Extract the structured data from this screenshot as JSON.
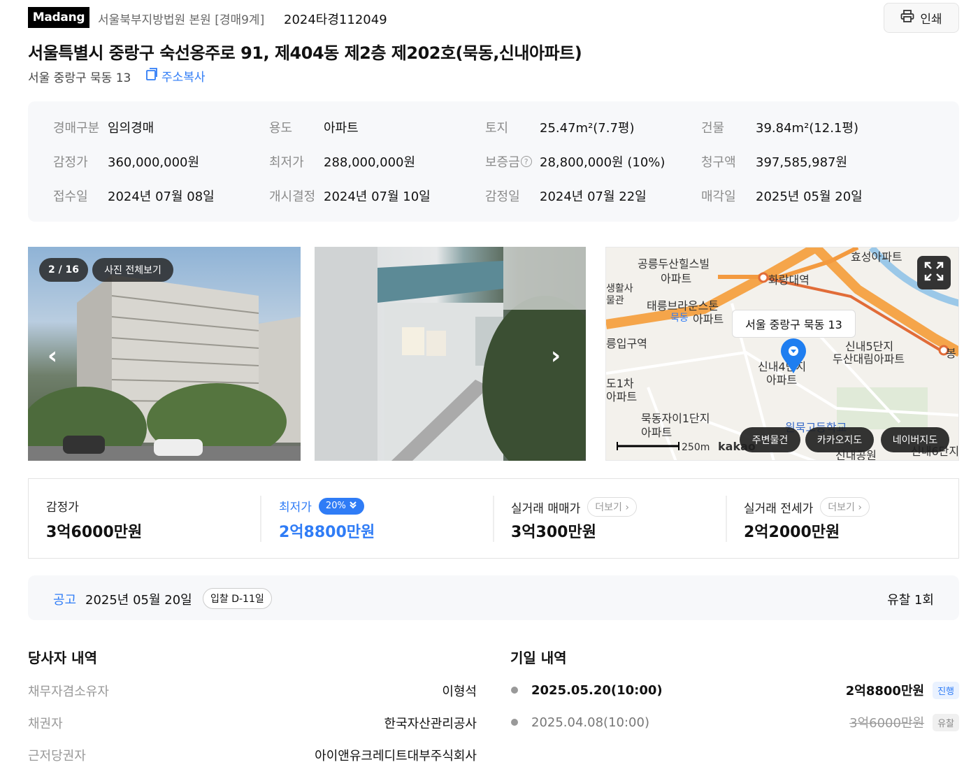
{
  "header": {
    "logo": "Madang",
    "court": "서울북부지방법원 본원 [경매9계]",
    "case_number": "2024타경112049",
    "print_label": "인쇄"
  },
  "property": {
    "title": "서울특별시 중랑구 숙선옹주로 91, 제404동 제2층 제202호(묵동,신내아파트)",
    "sub_address": "서울 중랑구 묵동 13",
    "copy_label": "주소복사"
  },
  "info": [
    {
      "label": "경매구분",
      "value": "임의경매"
    },
    {
      "label": "용도",
      "value": "아파트"
    },
    {
      "label": "토지",
      "value": "25.47m²(7.7평)"
    },
    {
      "label": "건물",
      "value": "39.84m²(12.1평)"
    },
    {
      "label": "감정가",
      "value": "360,000,000원"
    },
    {
      "label": "최저가",
      "value": "288,000,000원"
    },
    {
      "label": "보증금",
      "value": "28,800,000원 (10%)"
    },
    {
      "label": "청구액",
      "value": "397,585,987원"
    },
    {
      "label": "접수일",
      "value": "2024년 07월 08일"
    },
    {
      "label": "개시결정",
      "value": "2024년 07월 10일"
    },
    {
      "label": "감정일",
      "value": "2024년 07월 22일"
    },
    {
      "label": "매각일",
      "value": "2025년 05월 20일"
    }
  ],
  "gallery": {
    "counter": "2 / 16",
    "view_all": "사진 전체보기"
  },
  "map": {
    "callout": "서울 중랑구 묵동 13",
    "labels": [
      "공릉두산힐스빌",
      "아파트",
      "화랑대역",
      "효성아파트",
      "생활사",
      "물관",
      "태릉브라운스톤",
      "묵동",
      "아파트",
      "릉입구역",
      "신내5단지",
      "두산대림아파트",
      "신내4단지",
      "아파트",
      "도1차",
      "아파트",
      "묵동자이1단지",
      "아파트",
      "원묵고등학교",
      "신내공원",
      "신내6단지",
      "봉"
    ],
    "scale": "250m",
    "brand": "kakao",
    "buttons": [
      "주변물건",
      "카카오지도",
      "네이버지도"
    ]
  },
  "prices": {
    "appraisal": {
      "label": "감정가",
      "value": "3억6000만원"
    },
    "minimum": {
      "label": "최저가",
      "badge": "20%",
      "value": "2억8800만원"
    },
    "trade": {
      "label": "실거래 매매가",
      "more": "더보기",
      "value": "3억300만원"
    },
    "jeonse": {
      "label": "실거래 전세가",
      "more": "더보기",
      "value": "2억2000만원"
    }
  },
  "notice": {
    "label": "공고",
    "date": "2025년 05월 20일",
    "dday": "입찰 D-11일",
    "fail_count": "유찰 1회"
  },
  "parties": {
    "title": "당사자 내역",
    "rows": [
      {
        "role": "채무자겸소유자",
        "name": "이형석"
      },
      {
        "role": "채권자",
        "name": "한국자산관리공사"
      },
      {
        "role": "근저당권자",
        "name": "아이앤유크레디트대부주식회사"
      }
    ]
  },
  "dates": {
    "title": "기일 내역",
    "rows": [
      {
        "date": "2025.05.20(10:00)",
        "price": "2억8800만원",
        "status": "진행"
      },
      {
        "date": "2025.04.08(10:00)",
        "price": "3억6000만원",
        "status": "유찰"
      }
    ]
  },
  "colors": {
    "accent": "#2f7cf6"
  }
}
